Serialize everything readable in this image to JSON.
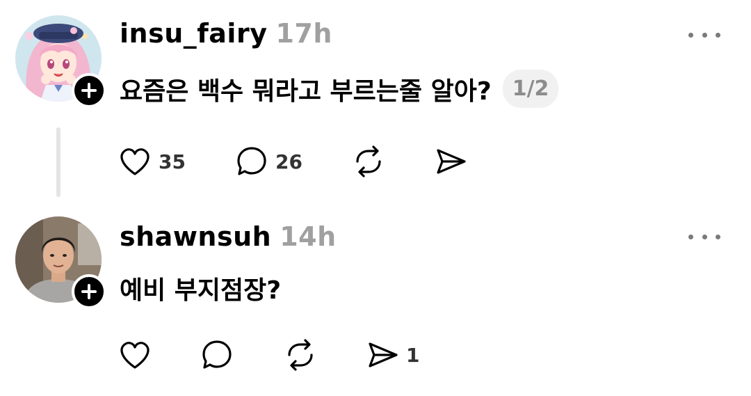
{
  "posts": [
    {
      "username": "insu_fairy",
      "time": "17h",
      "text": "요즘은 백수 뭐라고 부르는줄 알아?",
      "page_indicator": "1/2",
      "likes": "35",
      "comments": "26",
      "reposts": "",
      "shares": ""
    },
    {
      "username": "shawnsuh",
      "time": "14h",
      "text": "예비 부지점장?",
      "likes": "",
      "comments": "",
      "reposts": "",
      "shares": "1"
    }
  ],
  "icons": {
    "like": "heart-icon",
    "comment": "speech-bubble-icon",
    "repost": "repost-icon",
    "share": "send-icon",
    "more": "more-dots-icon",
    "follow": "plus-icon"
  },
  "colors": {
    "text": "#000000",
    "muted": "#a0a0a0",
    "pill_bg": "#f1f1f1",
    "thread_line": "#e4e4e4"
  }
}
